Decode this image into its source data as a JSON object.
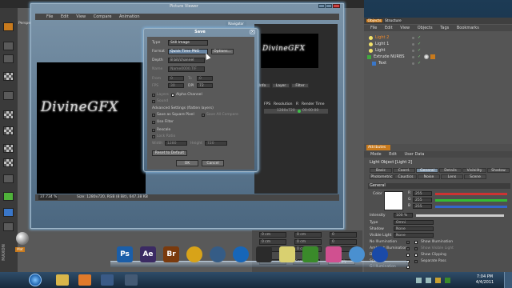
{
  "picture_viewer": {
    "title": "Picture Viewer",
    "menu": [
      "File",
      "Edit",
      "View",
      "Compare",
      "Animation"
    ],
    "viewport_label": "Perspe",
    "logo": "DivineGFX",
    "status_zoom": "37.734 %",
    "status_size": "Size: 1280x720, RGB (8 Bit), 647.38 KB",
    "navigator_tab": "Navigator",
    "side_tabs": [
      "Info",
      "Layer",
      "Filter"
    ],
    "table_headers": [
      "FPS",
      "Resolution",
      "R",
      "Render Time"
    ],
    "table_row": [
      "",
      "1280x720",
      "",
      "00:00:00"
    ]
  },
  "save_dialog": {
    "title": "Save",
    "type_label": "Type",
    "type_value": "Still Image",
    "format_label": "Format",
    "format_value": "Quick Time PNG",
    "options_label": "Options...",
    "depth_label": "Depth",
    "depth_value": "8 bit/channel",
    "name_label": "Name",
    "name_value": "Name0000.TIF",
    "from_label": "From",
    "from_value": "0",
    "to_label": "To",
    "to_value": "0",
    "fps_label": "FPS",
    "fps_value": "30",
    "dpi_label": "DPI",
    "dpi_value": "72",
    "layers_label": "Layers",
    "alpha_label": "Alpha Channel",
    "sound_label": "Sound",
    "advanced_label": "Advanced Settings (flatten layers)",
    "square_pixel_label": "Save as Square Pixel",
    "save_compare_label": "Save All Compare",
    "use_filter_label": "Use Filter",
    "rescale_label": "Rescale",
    "lock_ratio_label": "Lock Ratio",
    "width_label": "Width",
    "width_value": "1280",
    "height_label": "Height",
    "height_value": "720",
    "reset_label": "Reset to Default",
    "ok_label": "OK",
    "cancel_label": "Cancel"
  },
  "objects_panel": {
    "tabs": [
      "Objects",
      "Structure"
    ],
    "menu": [
      "File",
      "Edit",
      "View",
      "Objects",
      "Tags",
      "Bookmarks"
    ],
    "items": [
      "Light 2",
      "Light 1",
      "Light",
      "Extrude NURBS",
      "Text"
    ]
  },
  "attributes_panel": {
    "tab": "Attributes",
    "menu": [
      "Mode",
      "Edit",
      "User Data"
    ],
    "object_title": "Light Object [Light 2]",
    "tabs_row1": [
      "Basic",
      "Coord.",
      "General",
      "Details",
      "Visibility",
      "Shadow"
    ],
    "tabs_row2": [
      "Photometric",
      "Caustics",
      "Noise",
      "Lens",
      "Scene"
    ],
    "section": "General",
    "color_label": "Color",
    "rgb": [
      {
        "ch": "R",
        "value": "255"
      },
      {
        "ch": "G",
        "value": "255"
      },
      {
        "ch": "B",
        "value": "255"
      }
    ],
    "intensity_label": "Intensity",
    "intensity_value": "100 %",
    "type_label": "Type",
    "type_value": "Omni",
    "shadow_label": "Shadow",
    "shadow_value": "None",
    "visible_light_label": "Visible Light",
    "visible_light_value": "None",
    "no_illum_label": "No Illumination",
    "show_illum_label": "Show Illumination",
    "ambient_label": "Ambient Illumination",
    "show_visible_label": "Show Visible Light",
    "diffuse_label": "Diffuse",
    "show_clipping_label": "Show Clipping",
    "specular_label": "Specular",
    "separate_pass_label": "Separate Pass",
    "gi_label": "GI Illumination"
  },
  "coords": {
    "rows": [
      {
        "a": "0 cm",
        "b": "0 cm",
        "c": "0"
      },
      {
        "a": "0 cm",
        "b": "0 cm",
        "c": "0"
      },
      {
        "a": "0 cm",
        "b": "0 cm",
        "c": "0"
      }
    ],
    "world": "World",
    "scale": "Scale",
    "apply": "Apply"
  },
  "material": {
    "label": "Mat"
  },
  "maxon": "MAXON",
  "dock": [
    {
      "name": "photoshop",
      "label": "Ps",
      "color": "#1b5ea8"
    },
    {
      "name": "after-effects",
      "label": "Ae",
      "color": "#3b2a63"
    },
    {
      "name": "bridge",
      "label": "Br",
      "color": "#7a3a0d"
    },
    {
      "name": "chrome",
      "label": "",
      "color": "#d8a318"
    },
    {
      "name": "cinema4d",
      "label": "",
      "color": "#355c86"
    },
    {
      "name": "teamviewer",
      "label": "",
      "color": "#1766b8"
    },
    {
      "name": "steam",
      "label": "",
      "color": "#2b2b2b"
    },
    {
      "name": "notes",
      "label": "",
      "color": "#d9d070"
    },
    {
      "name": "xbox",
      "label": "",
      "color": "#3a8a2a"
    },
    {
      "name": "flower",
      "label": "",
      "color": "#d05090"
    },
    {
      "name": "magnifier",
      "label": "",
      "color": "#4a90d0"
    },
    {
      "name": "globe",
      "label": "",
      "color": "#1a4aa8"
    }
  ],
  "clock": {
    "time": "7:04 PM",
    "date": "4/4/2011"
  },
  "colors": {
    "accent": "#c87a1d",
    "titlebar": "#4b6780"
  }
}
